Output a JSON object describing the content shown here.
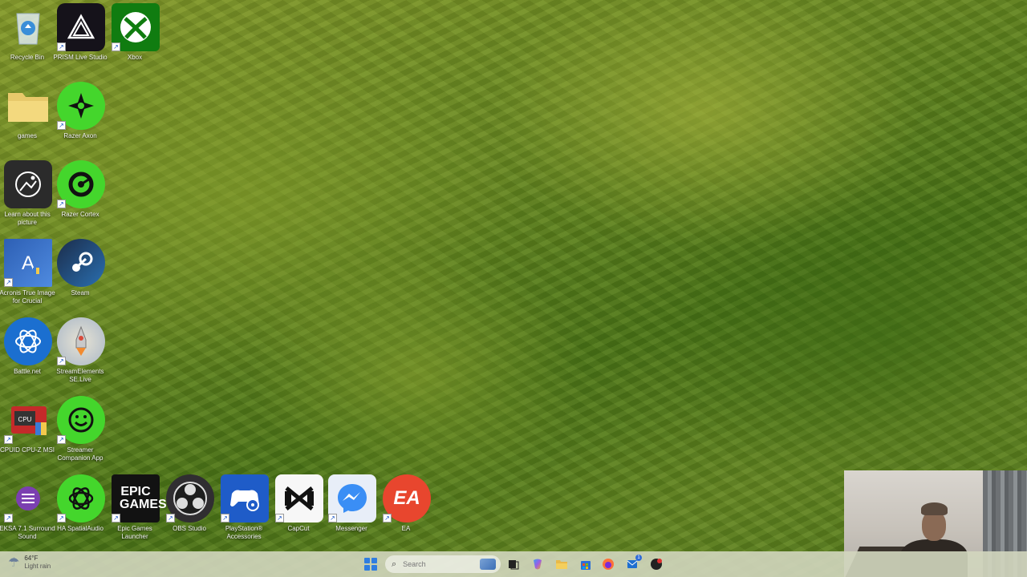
{
  "desktop": {
    "icons": [
      {
        "label": "Recycle Bin",
        "icon": "recycle-bin-icon"
      },
      {
        "label": "PRISM Live Studio",
        "icon": "prism-icon"
      },
      {
        "label": "Xbox",
        "icon": "xbox-icon"
      },
      {
        "label": "games",
        "icon": "folder-icon"
      },
      {
        "label": "Razer Axon",
        "icon": "razer-axon-icon"
      },
      {
        "label": "Learn about this picture",
        "icon": "camera-icon"
      },
      {
        "label": "Razer Cortex",
        "icon": "razer-cortex-icon"
      },
      {
        "label": "Acronis True Image for Crucial",
        "icon": "acronis-icon"
      },
      {
        "label": "Steam",
        "icon": "steam-icon"
      },
      {
        "label": "Battle.net",
        "icon": "battlenet-icon"
      },
      {
        "label": "StreamElements SE.Live",
        "icon": "rocket-icon"
      },
      {
        "label": "CPUID CPU-Z MSI",
        "icon": "cpuz-icon"
      },
      {
        "label": "Streamer Companion App",
        "icon": "smiley-icon"
      },
      {
        "label": "EKSA 7.1 Surround Sound",
        "icon": "eksa-icon"
      },
      {
        "label": "HA SpatialAudio",
        "icon": "spatial-audio-icon"
      },
      {
        "label": "Epic Games Launcher",
        "icon": "epic-games-icon"
      },
      {
        "label": "OBS Studio",
        "icon": "obs-icon"
      },
      {
        "label": "PlayStation® Accessories",
        "icon": "playstation-icon"
      },
      {
        "label": "CapCut",
        "icon": "capcut-icon"
      },
      {
        "label": "Messenger",
        "icon": "messenger-icon"
      },
      {
        "label": "EA",
        "icon": "ea-icon"
      }
    ],
    "epic_logo_text": "EPIC GAMES",
    "ea_logo_text": "EA"
  },
  "taskbar": {
    "weather": {
      "temp": "64°F",
      "condition": "Light rain"
    },
    "search_placeholder": "Search",
    "apps": [
      {
        "name": "task-view-icon",
        "glyph": "▭"
      },
      {
        "name": "copilot-icon",
        "glyph": "✦"
      },
      {
        "name": "file-explorer-icon",
        "glyph": "▬"
      },
      {
        "name": "store-icon",
        "glyph": "▦"
      },
      {
        "name": "firefox-icon",
        "glyph": "●"
      },
      {
        "name": "outlook-icon",
        "glyph": "✉"
      },
      {
        "name": "app-icon",
        "glyph": "◉"
      }
    ],
    "badge_count": "1"
  },
  "colors": {
    "taskbar_bg": "#d2d6be",
    "accent": "#2f7de0",
    "razer_green": "#44d62c"
  }
}
